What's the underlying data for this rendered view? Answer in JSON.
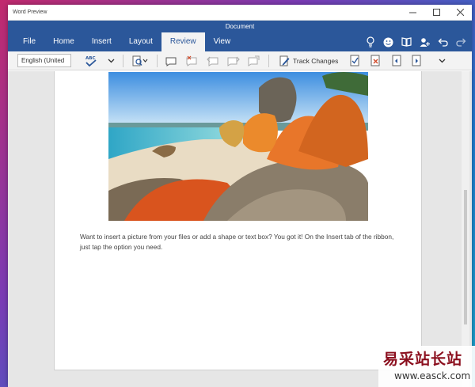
{
  "app": {
    "title": "Word Preview"
  },
  "document": {
    "title": "Document",
    "body_text": "Want to insert a picture from your files or add a shape or text box? You got it! On the Insert tab of the ribbon, just tap the option you need."
  },
  "tabs": [
    {
      "label": "File"
    },
    {
      "label": "Home"
    },
    {
      "label": "Insert"
    },
    {
      "label": "Layout"
    },
    {
      "label": "Review",
      "active": true
    },
    {
      "label": "View"
    }
  ],
  "ribbon_icons": [
    "lightbulb-icon",
    "smiley-icon",
    "book-icon",
    "person-add-icon",
    "undo-icon",
    "redo-icon"
  ],
  "review_toolbar": {
    "language_value": "English (United",
    "track_changes_label": "Track Changes"
  },
  "watermark": {
    "chinese": "易采站长站",
    "url": "www.easck.com"
  },
  "colors": {
    "ribbon": "#2b579a",
    "toolbar": "#f3f3f3"
  }
}
